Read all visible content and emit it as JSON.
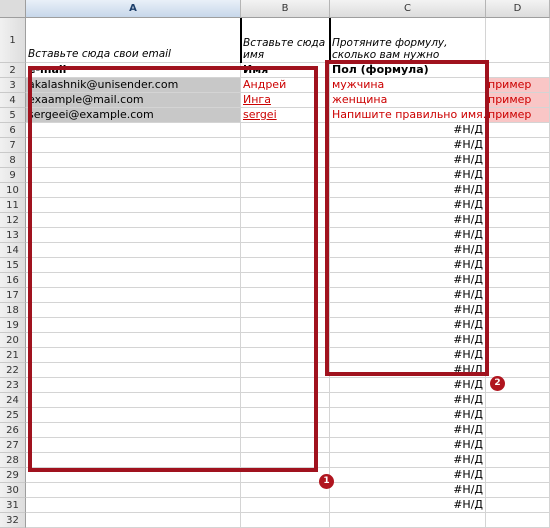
{
  "columns": [
    "A",
    "B",
    "C",
    "D"
  ],
  "row1": {
    "num": "1",
    "a": "Вставьте сюда свои email",
    "b": "Вставьте сюда имя",
    "c": "Протяните формулу, сколько вам нужно"
  },
  "row2": {
    "num": "2",
    "a": "e-mail",
    "b": "Имя",
    "c": "Пол (формула)"
  },
  "data_rows": [
    {
      "num": "3",
      "a": "akalashnik@unisender.com",
      "b": "Андрей",
      "c": "мужчина",
      "d": "пример"
    },
    {
      "num": "4",
      "a": "exaample@mail.com",
      "b": "Инга",
      "c": "женщина",
      "d": "пример"
    },
    {
      "num": "5",
      "a": "sergeei@example.com",
      "b": "sergei",
      "c": "Напишите правильно имя.",
      "d": "пример"
    }
  ],
  "na_value": "#Н/Д",
  "row_numbers": [
    "6",
    "7",
    "8",
    "9",
    "10",
    "11",
    "12",
    "13",
    "14",
    "15",
    "16",
    "17",
    "18",
    "19",
    "20",
    "21",
    "22",
    "23",
    "24",
    "25",
    "26",
    "27",
    "28",
    "29",
    "30",
    "31",
    "32"
  ],
  "badges": {
    "one": "1",
    "two": "2"
  },
  "colors": {
    "highlight_border": "#a0121e",
    "text_red": "#cc0000",
    "example_bg": "#f9c6c6",
    "selection_grey": "#c8c8c8"
  }
}
